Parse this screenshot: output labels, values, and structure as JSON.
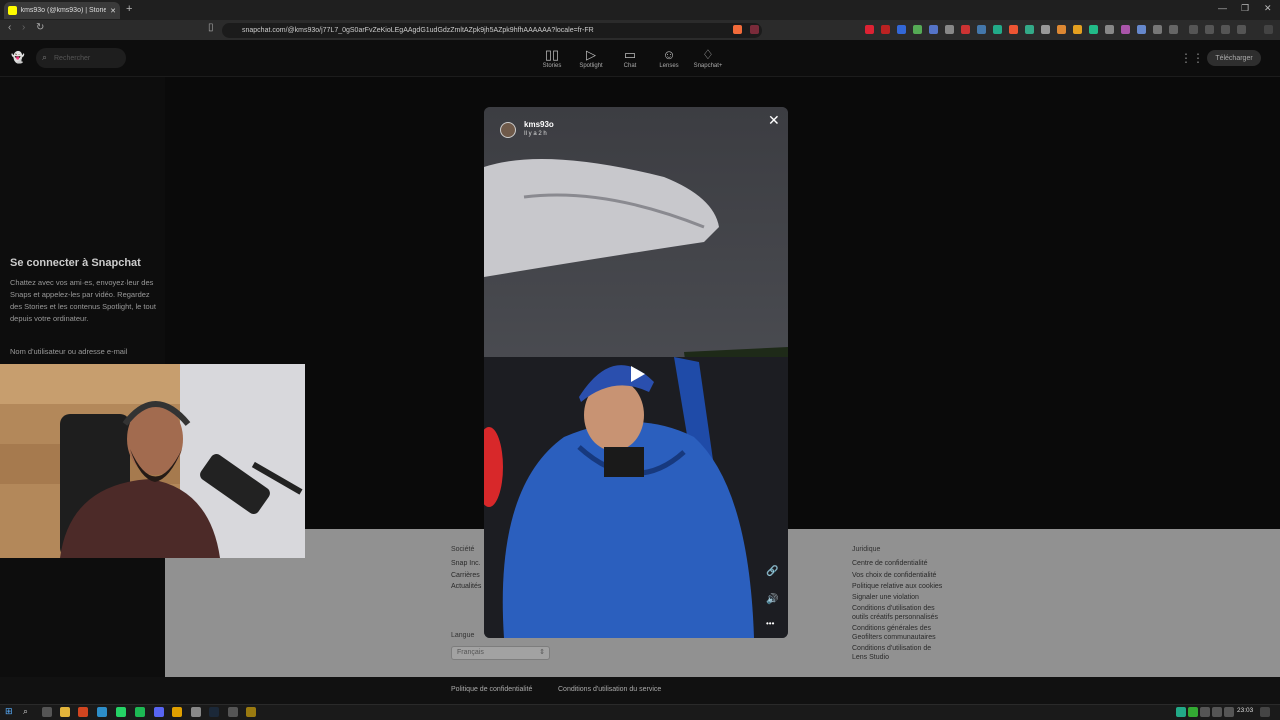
{
  "browser": {
    "tab_title": "kms93o (@kms93o) | Stories, Sp...",
    "tab_close": "✕",
    "new_tab": "+",
    "url": "snapchat.com/@kms93o/j77L7_0gS0arFvZeKioLEgAAgdG1udGdzZmltAZpk9jh5AZpk9hfhAAAAAA?locale=fr-FR",
    "window_controls": [
      "—",
      "❐",
      "✕"
    ]
  },
  "header": {
    "search_placeholder": "Rechercher",
    "nav": [
      {
        "label": "Stories",
        "icon": "stories-icon",
        "glyph": "▯▯"
      },
      {
        "label": "Spotlight",
        "icon": "spotlight-icon",
        "glyph": "▷"
      },
      {
        "label": "Chat",
        "icon": "chat-icon",
        "glyph": "▭"
      },
      {
        "label": "Lenses",
        "icon": "lenses-icon",
        "glyph": "☺"
      },
      {
        "label": "Snapchat+",
        "icon": "snapchat-plus-icon",
        "glyph": "♢"
      }
    ],
    "download_label": "Télécharger"
  },
  "left_panel": {
    "title": "Se connecter à Snapchat",
    "description": "Chattez avec vos ami·es, envoyez·leur des Snaps et appelez-les par vidéo. Regardez des Stories et les contenus Spotlight, le tout depuis votre ordinateur.",
    "username_label": "Nom d'utilisateur ou adresse e-mail"
  },
  "story": {
    "username": "kms93o",
    "time": "Il y a 2 h",
    "close": "✕",
    "link_icon": "🔗",
    "volume_icon": "🔊",
    "more_icon": "•••"
  },
  "footer": {
    "company": {
      "heading": "Société",
      "links": [
        "Snap Inc.",
        "Carrières",
        "Actualités"
      ]
    },
    "legal": {
      "heading": "Juridique",
      "links": [
        "Centre de confidentialité",
        "Vos choix de confidentialité",
        "Politique relative aux cookies",
        "Signaler une violation",
        "Conditions d'utilisation des outils créatifs personnalisés",
        "Conditions générales des Geofilters communautaires",
        "Conditions d'utilisation de Lens Studio"
      ]
    },
    "language_label": "Langue",
    "language_value": "Français",
    "bottom_links": [
      "Politique de confidentialité",
      "Conditions d'utilisation du service"
    ]
  },
  "taskbar": {
    "clock": "23:03"
  },
  "colors": {
    "snap_yellow": "#fffc00",
    "jacket_blue": "#2b5fbe",
    "footer_gray": "#919191"
  }
}
